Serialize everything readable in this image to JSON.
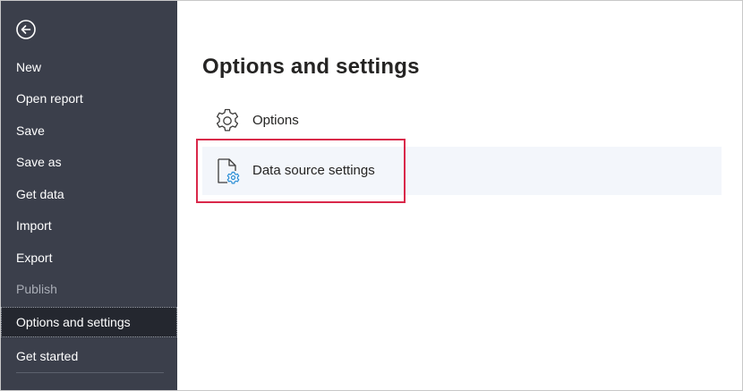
{
  "sidebar": {
    "back_icon": "back-arrow-circle-icon",
    "items": [
      {
        "label": "New",
        "state": "normal"
      },
      {
        "label": "Open report",
        "state": "normal"
      },
      {
        "label": "Save",
        "state": "normal"
      },
      {
        "label": "Save as",
        "state": "normal"
      },
      {
        "label": "Get data",
        "state": "normal"
      },
      {
        "label": "Import",
        "state": "normal"
      },
      {
        "label": "Export",
        "state": "normal"
      },
      {
        "label": "Publish",
        "state": "disabled"
      },
      {
        "label": "Options and settings",
        "state": "selected"
      },
      {
        "label": "Get started",
        "state": "normal"
      }
    ]
  },
  "main": {
    "title": "Options and settings",
    "options": [
      {
        "label": "Options",
        "icon": "gear-icon"
      },
      {
        "label": "Data source settings",
        "icon": "document-gear-icon",
        "highlighted": true
      }
    ]
  },
  "colors": {
    "sidebar_bg": "#3b3f4b",
    "sidebar_selected_bg": "#24272f",
    "highlight_border": "#d9284a",
    "accent_blue": "#2b8fd6"
  }
}
